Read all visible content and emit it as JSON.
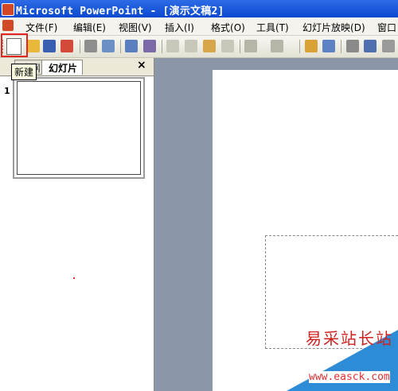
{
  "window": {
    "title": "Microsoft PowerPoint - [演示文稿2]"
  },
  "menu": [
    {
      "label": "文件",
      "key": "(F)"
    },
    {
      "label": "编辑",
      "key": "(E)"
    },
    {
      "label": "视图",
      "key": "(V)"
    },
    {
      "label": "插入",
      "key": "(I)"
    },
    {
      "label": "格式",
      "key": "(O)"
    },
    {
      "label": "工具",
      "key": "(T)"
    },
    {
      "label": "幻灯片放映",
      "key": "(D)"
    },
    {
      "label": "窗口",
      "key": ""
    }
  ],
  "toolbar": {
    "new_tooltip": "新建",
    "icons": [
      "new-icon",
      "open-icon",
      "save-icon",
      "permission-icon",
      "print-icon",
      "print-preview-icon",
      "spelling-icon",
      "research-icon",
      "cut-icon",
      "copy-icon",
      "paste-icon",
      "format-painter-icon",
      "undo-icon",
      "redo-icon",
      "insert-chart-icon",
      "insert-table-icon",
      "expand-all-icon",
      "show-formatting-icon",
      "grid-icon"
    ]
  },
  "pane": {
    "tabs": [
      {
        "label": "大纲"
      },
      {
        "label": "幻灯片"
      }
    ],
    "close": "×",
    "slide_number": "1"
  },
  "watermark": {
    "text": "易采站长站",
    "url": "www.easck.com"
  },
  "colors": {
    "highlight": "#E0261E",
    "titlebar": "#0A48D0",
    "workarea": "#8B97A8"
  }
}
